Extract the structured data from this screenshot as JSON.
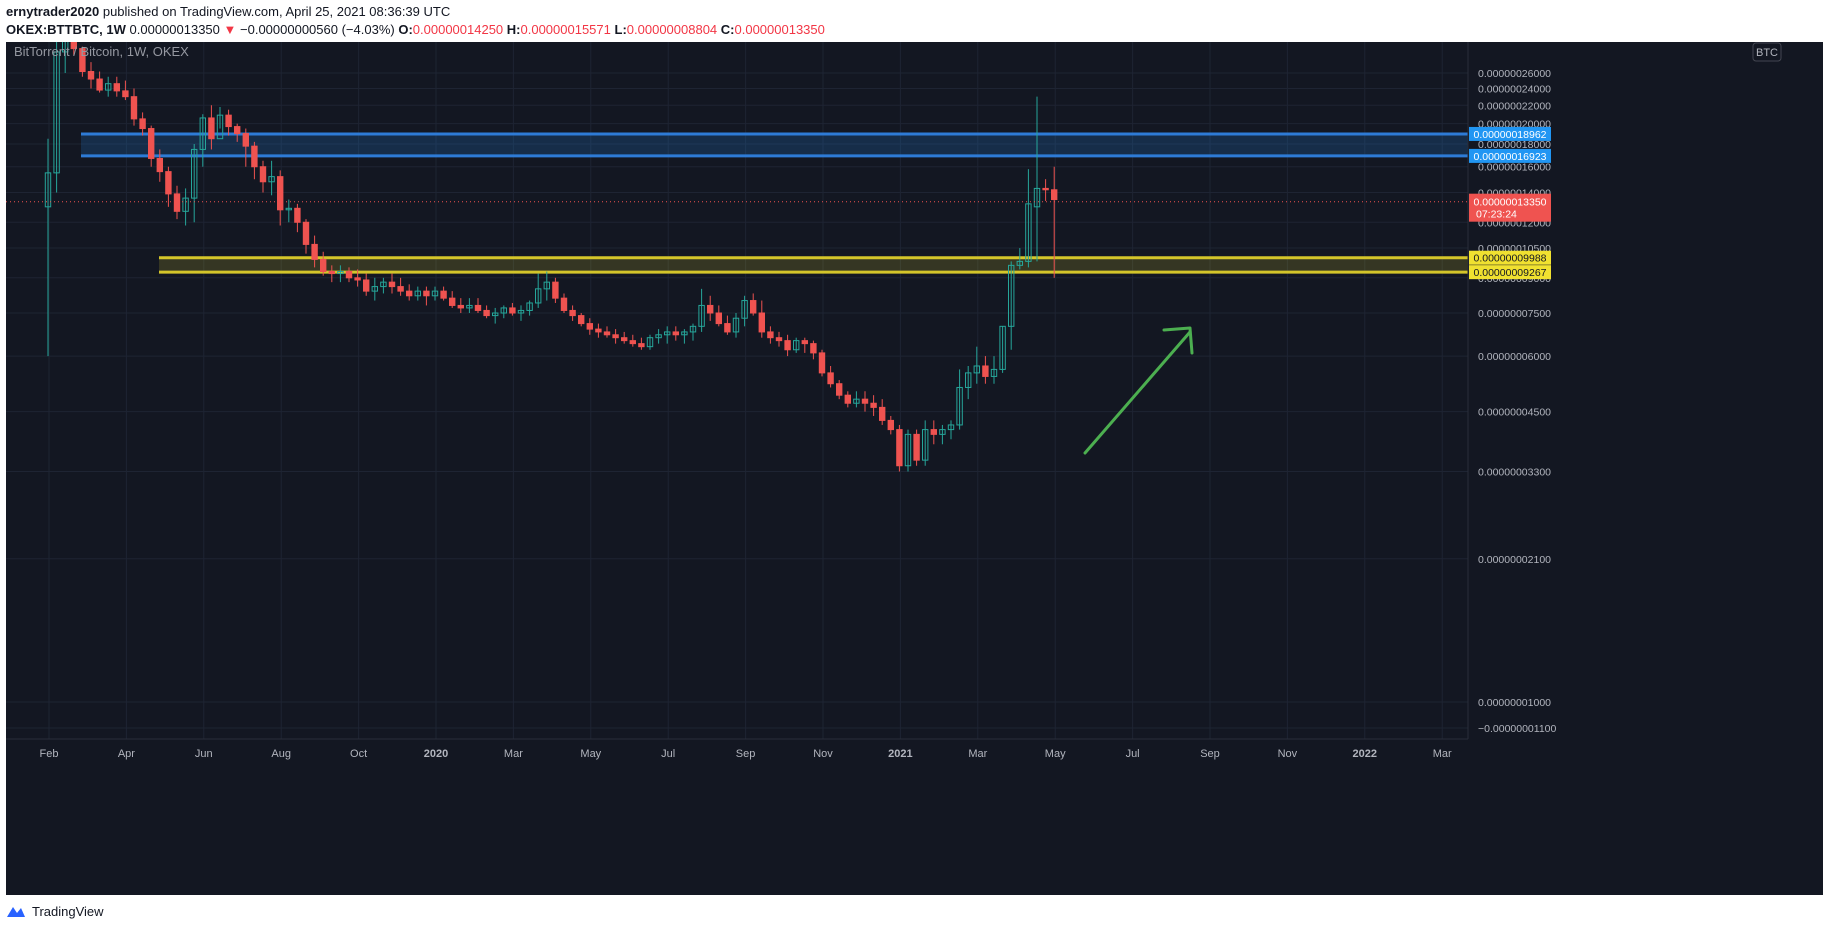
{
  "header": {
    "author": "ernytrader2020",
    "published_text": " published on TradingView.com, April 25, 2021 08:36:39 UTC"
  },
  "ohlc": {
    "symbol": "OKEX:BTTBTC, 1W",
    "last": "0.00000013350",
    "change_arrow": "▼",
    "change": "−0.00000000560 (−4.03%)",
    "o_label": "O:",
    "o": "0.00000014250",
    "h_label": "H:",
    "h": "0.00000015571",
    "l_label": "L:",
    "l": "0.00000008804",
    "c_label": "C:",
    "c": "0.00000013350"
  },
  "footer": {
    "brand": "TradingView",
    "brand_icon": "tradingview-logo-icon"
  },
  "colors": {
    "background": "#131722",
    "grid": "#1e2433",
    "up": "#26a69a",
    "down": "#ef5350",
    "blue_zone": "#1e6fbf",
    "yellow_zone": "#d4c52a",
    "arrow": "#4caf50",
    "axis_text": "#b2b5be"
  },
  "chart_data": {
    "type": "candlestick",
    "title": "BitTorrent / Bitcoin, 1W, OKEX",
    "currency_badge": "BTC",
    "y_scale": "log",
    "y_tick_labels": [
      "0.00000026000",
      "0.00000024000",
      "0.00000022000",
      "0.00000020000",
      "0.00000018000",
      "0.00000016000",
      "0.00000014000",
      "0.00000012000",
      "0.00000010500",
      "0.00000009000",
      "0.00000007500",
      "0.00000006000",
      "0.00000004500",
      "0.00000003300",
      "0.00000002100",
      "0.00000001000",
      "−0.00000001100"
    ],
    "x_tick_labels": [
      "Feb",
      "Apr",
      "Jun",
      "Aug",
      "Oct",
      "2020",
      "Mar",
      "May",
      "Jul",
      "Sep",
      "Nov",
      "2021",
      "Mar",
      "May",
      "Jul",
      "Sep",
      "Nov",
      "2022",
      "Mar"
    ],
    "x_tick_bold": [
      "2020",
      "2021",
      "2022"
    ],
    "zones": [
      {
        "name": "resistance",
        "top": "0.00000018962",
        "bottom": "0.00000016923",
        "color": "blue"
      },
      {
        "name": "support",
        "top": "0.00000009988",
        "bottom": "0.00000009267",
        "color": "yellow"
      }
    ],
    "last_price": {
      "value": "0.00000013350",
      "countdown": "07:23:24"
    },
    "candles": [
      [
        1.3,
        1.85,
        0.6,
        1.55
      ],
      [
        1.55,
        3.2,
        1.4,
        2.9
      ],
      [
        2.9,
        3.4,
        2.6,
        3.1
      ],
      [
        3.1,
        3.25,
        2.85,
        2.95
      ],
      [
        2.95,
        2.98,
        2.55,
        2.62
      ],
      [
        2.62,
        2.75,
        2.4,
        2.52
      ],
      [
        2.52,
        2.62,
        2.35,
        2.38
      ],
      [
        2.38,
        2.55,
        2.3,
        2.46
      ],
      [
        2.46,
        2.55,
        2.3,
        2.37
      ],
      [
        2.37,
        2.5,
        2.26,
        2.3
      ],
      [
        2.3,
        2.4,
        1.98,
        2.05
      ],
      [
        2.05,
        2.12,
        1.88,
        1.95
      ],
      [
        1.95,
        1.98,
        1.6,
        1.67
      ],
      [
        1.67,
        1.75,
        1.48,
        1.56
      ],
      [
        1.56,
        1.6,
        1.3,
        1.39
      ],
      [
        1.39,
        1.45,
        1.22,
        1.27
      ],
      [
        1.27,
        1.43,
        1.18,
        1.36
      ],
      [
        1.36,
        1.8,
        1.2,
        1.75
      ],
      [
        1.75,
        2.1,
        1.6,
        2.06
      ],
      [
        2.06,
        2.2,
        1.75,
        1.85
      ],
      [
        1.85,
        2.18,
        1.95,
        2.09
      ],
      [
        2.09,
        2.15,
        1.88,
        1.97
      ],
      [
        1.97,
        2.0,
        1.82,
        1.9
      ],
      [
        1.9,
        1.95,
        1.6,
        1.78
      ],
      [
        1.78,
        1.82,
        1.5,
        1.6
      ],
      [
        1.6,
        1.65,
        1.4,
        1.48
      ],
      [
        1.48,
        1.65,
        1.38,
        1.52
      ],
      [
        1.52,
        1.57,
        1.18,
        1.28
      ],
      [
        1.28,
        1.35,
        1.2,
        1.29
      ],
      [
        1.29,
        1.32,
        1.14,
        1.2
      ],
      [
        1.2,
        1.22,
        1.02,
        1.07
      ],
      [
        1.07,
        1.12,
        0.95,
        0.99
      ],
      [
        0.99,
        1.03,
        0.91,
        0.93
      ],
      [
        0.93,
        0.96,
        0.88,
        0.92
      ],
      [
        0.92,
        0.96,
        0.88,
        0.93
      ],
      [
        0.93,
        0.95,
        0.88,
        0.9
      ],
      [
        0.9,
        0.94,
        0.86,
        0.89
      ],
      [
        0.89,
        0.92,
        0.82,
        0.84
      ],
      [
        0.84,
        0.9,
        0.8,
        0.86
      ],
      [
        0.86,
        0.9,
        0.83,
        0.88
      ],
      [
        0.88,
        0.92,
        0.83,
        0.86
      ],
      [
        0.86,
        0.9,
        0.82,
        0.84
      ],
      [
        0.84,
        0.87,
        0.8,
        0.82
      ],
      [
        0.82,
        0.86,
        0.8,
        0.84
      ],
      [
        0.84,
        0.86,
        0.78,
        0.82
      ],
      [
        0.82,
        0.86,
        0.8,
        0.84
      ],
      [
        0.84,
        0.86,
        0.8,
        0.81
      ],
      [
        0.81,
        0.84,
        0.77,
        0.78
      ],
      [
        0.78,
        0.81,
        0.75,
        0.77
      ],
      [
        0.77,
        0.81,
        0.75,
        0.78
      ],
      [
        0.78,
        0.81,
        0.75,
        0.76
      ],
      [
        0.76,
        0.78,
        0.73,
        0.74
      ],
      [
        0.74,
        0.77,
        0.71,
        0.75
      ],
      [
        0.75,
        0.78,
        0.73,
        0.77
      ],
      [
        0.77,
        0.79,
        0.74,
        0.75
      ],
      [
        0.75,
        0.78,
        0.72,
        0.76
      ],
      [
        0.76,
        0.8,
        0.74,
        0.79
      ],
      [
        0.79,
        0.92,
        0.77,
        0.85
      ],
      [
        0.85,
        0.93,
        0.8,
        0.88
      ],
      [
        0.88,
        0.9,
        0.79,
        0.81
      ],
      [
        0.81,
        0.83,
        0.75,
        0.76
      ],
      [
        0.76,
        0.78,
        0.72,
        0.74
      ],
      [
        0.74,
        0.75,
        0.7,
        0.71
      ],
      [
        0.71,
        0.73,
        0.67,
        0.69
      ],
      [
        0.69,
        0.71,
        0.66,
        0.68
      ],
      [
        0.68,
        0.7,
        0.66,
        0.67
      ],
      [
        0.67,
        0.69,
        0.64,
        0.66
      ],
      [
        0.66,
        0.68,
        0.64,
        0.65
      ],
      [
        0.65,
        0.67,
        0.63,
        0.64
      ],
      [
        0.64,
        0.66,
        0.62,
        0.63
      ],
      [
        0.63,
        0.67,
        0.62,
        0.66
      ],
      [
        0.66,
        0.69,
        0.64,
        0.67
      ],
      [
        0.67,
        0.7,
        0.64,
        0.68
      ],
      [
        0.68,
        0.7,
        0.65,
        0.67
      ],
      [
        0.67,
        0.69,
        0.64,
        0.68
      ],
      [
        0.68,
        0.71,
        0.65,
        0.7
      ],
      [
        0.7,
        0.85,
        0.68,
        0.78
      ],
      [
        0.78,
        0.82,
        0.72,
        0.75
      ],
      [
        0.75,
        0.78,
        0.7,
        0.71
      ],
      [
        0.71,
        0.74,
        0.67,
        0.68
      ],
      [
        0.68,
        0.75,
        0.66,
        0.73
      ],
      [
        0.73,
        0.82,
        0.7,
        0.8
      ],
      [
        0.8,
        0.83,
        0.74,
        0.75
      ],
      [
        0.75,
        0.8,
        0.66,
        0.68
      ],
      [
        0.68,
        0.7,
        0.64,
        0.66
      ],
      [
        0.66,
        0.68,
        0.63,
        0.65
      ],
      [
        0.65,
        0.67,
        0.6,
        0.62
      ],
      [
        0.62,
        0.66,
        0.61,
        0.65
      ],
      [
        0.65,
        0.66,
        0.61,
        0.64
      ],
      [
        0.64,
        0.65,
        0.59,
        0.61
      ],
      [
        0.61,
        0.62,
        0.54,
        0.55
      ],
      [
        0.55,
        0.57,
        0.51,
        0.52
      ],
      [
        0.52,
        0.53,
        0.48,
        0.49
      ],
      [
        0.49,
        0.5,
        0.46,
        0.47
      ],
      [
        0.47,
        0.5,
        0.46,
        0.48
      ],
      [
        0.48,
        0.5,
        0.45,
        0.47
      ],
      [
        0.47,
        0.49,
        0.44,
        0.46
      ],
      [
        0.46,
        0.48,
        0.42,
        0.43
      ],
      [
        0.43,
        0.44,
        0.4,
        0.41
      ],
      [
        0.41,
        0.42,
        0.33,
        0.34
      ],
      [
        0.34,
        0.41,
        0.33,
        0.4
      ],
      [
        0.4,
        0.41,
        0.34,
        0.35
      ],
      [
        0.35,
        0.43,
        0.34,
        0.41
      ],
      [
        0.41,
        0.43,
        0.38,
        0.4
      ],
      [
        0.4,
        0.42,
        0.38,
        0.41
      ],
      [
        0.41,
        0.43,
        0.39,
        0.42
      ],
      [
        0.42,
        0.56,
        0.41,
        0.51
      ],
      [
        0.51,
        0.57,
        0.48,
        0.55
      ],
      [
        0.55,
        0.63,
        0.52,
        0.57
      ],
      [
        0.57,
        0.6,
        0.52,
        0.54
      ],
      [
        0.54,
        0.6,
        0.52,
        0.56
      ],
      [
        0.56,
        0.7,
        0.55,
        0.7
      ],
      [
        0.7,
        0.98,
        0.62,
        0.96
      ],
      [
        0.96,
        1.05,
        0.94,
        0.98
      ],
      [
        0.98,
        1.58,
        0.95,
        1.32
      ],
      [
        1.3,
        2.3,
        0.98,
        1.43
      ],
      [
        1.43,
        1.5,
        1.34,
        1.42
      ],
      [
        1.42,
        1.6,
        0.9,
        1.35
      ]
    ]
  }
}
